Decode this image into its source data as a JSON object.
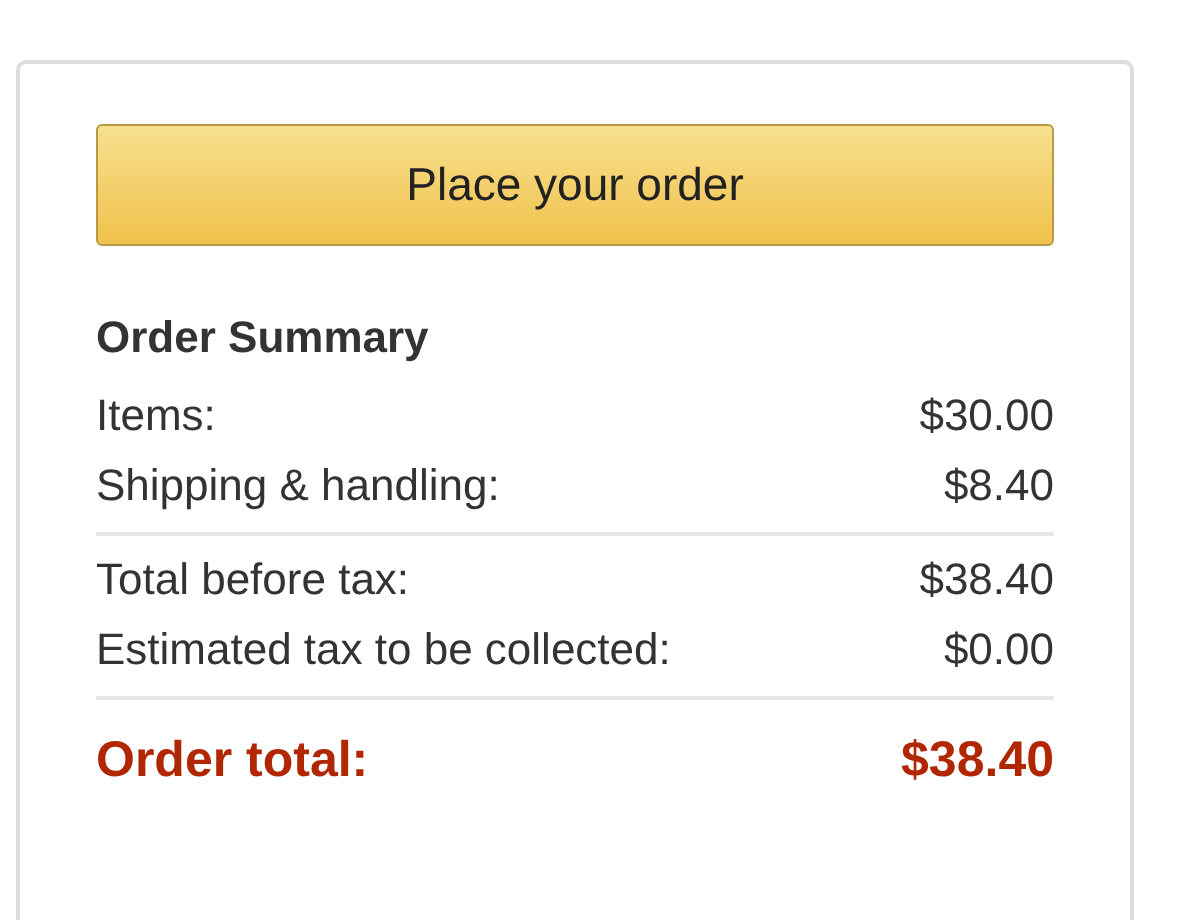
{
  "place_order_button": {
    "label": "Place your order"
  },
  "order_summary": {
    "title": "Order Summary",
    "sections": [
      {
        "rows": [
          {
            "kind": "line",
            "label": "Items:",
            "amount": "$30.00"
          },
          {
            "kind": "line",
            "label": "Shipping & handling:",
            "amount": "$8.40"
          }
        ]
      },
      {
        "rows": [
          {
            "kind": "line",
            "label": "Total before tax:",
            "amount": "$38.40"
          },
          {
            "kind": "line",
            "label": "Estimated tax to be collected:",
            "amount": "$0.00"
          }
        ]
      },
      {
        "rows": [
          {
            "kind": "total",
            "label": "Order total:",
            "amount": "$38.40"
          }
        ]
      }
    ]
  }
}
